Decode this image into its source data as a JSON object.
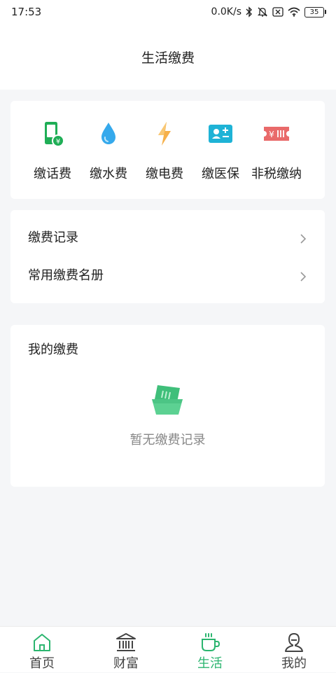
{
  "status_bar": {
    "time": "17:53",
    "network_speed": "0.0K/s",
    "battery_level": "35",
    "icons": [
      "bluetooth-icon",
      "mute-bell-icon",
      "sim-off-icon",
      "wifi-icon",
      "battery-icon"
    ]
  },
  "header": {
    "title": "生活缴费"
  },
  "services": [
    {
      "label": "缴话费",
      "icon": "phone-bill-icon",
      "color": "#1fae56"
    },
    {
      "label": "缴水费",
      "icon": "water-drop-icon",
      "color": "#35a9ec"
    },
    {
      "label": "缴电费",
      "icon": "lightning-icon",
      "color": "#f6b04a"
    },
    {
      "label": "缴医保",
      "icon": "medical-card-icon",
      "color": "#1eb3d6"
    },
    {
      "label": "非税缴纳",
      "icon": "ticket-icon",
      "color": "#e96a6a"
    }
  ],
  "links": [
    {
      "label": "缴费记录"
    },
    {
      "label": "常用缴费名册"
    }
  ],
  "my_payments": {
    "title": "我的缴费",
    "empty_text": "暂无缴费记录"
  },
  "tabs": [
    {
      "label": "首页",
      "icon": "home-icon",
      "active": false
    },
    {
      "label": "财富",
      "icon": "bank-icon",
      "active": false
    },
    {
      "label": "生活",
      "icon": "coffee-cup-icon",
      "active": true
    },
    {
      "label": "我的",
      "icon": "profile-icon",
      "active": false
    }
  ],
  "colors": {
    "accent": "#2bb56f",
    "background": "#f5f6f8"
  }
}
